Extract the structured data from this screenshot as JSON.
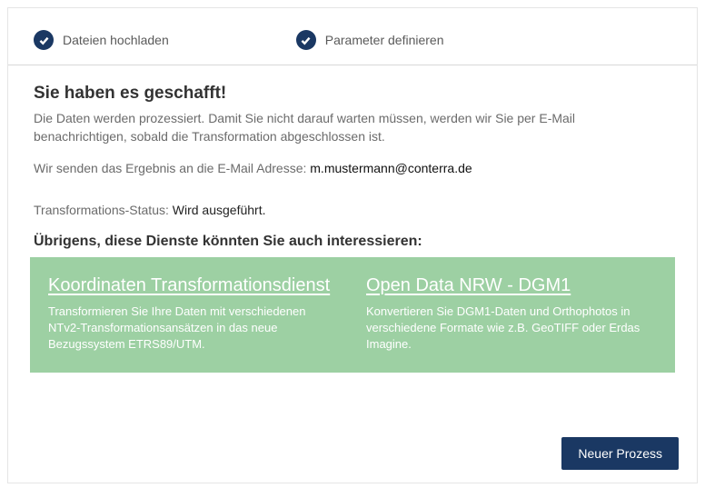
{
  "steps": [
    {
      "label": "Dateien hochladen"
    },
    {
      "label": "Parameter definieren"
    }
  ],
  "heading": "Sie haben es geschafft!",
  "intro": "Die Daten werden prozessiert. Damit Sie nicht darauf warten müssen, werden wir Sie per E-Mail benachrichtigen, sobald die Transformation abgeschlossen ist.",
  "email_prefix": "Wir senden das Ergebnis an die E-Mail Adresse: ",
  "email": "m.mustermann@conterra.de",
  "status_prefix": "Transformations-Status: ",
  "status_value": "Wird ausgeführt.",
  "services_heading": "Übrigens, diese Dienste könnten Sie auch interessieren:",
  "services": [
    {
      "title": "Koordinaten Transformationsdienst",
      "desc": "Transformieren Sie Ihre Daten mit verschiedenen NTv2-Transformationsansätzen in das neue Bezugssystem ETRS89/UTM."
    },
    {
      "title": "Open Data NRW - DGM1",
      "desc": "Konvertieren Sie DGM1-Daten und Orthophotos in verschiedene Formate wie z.B. GeoTIFF oder Erdas Imagine."
    }
  ],
  "new_process_label": "Neuer Prozess"
}
